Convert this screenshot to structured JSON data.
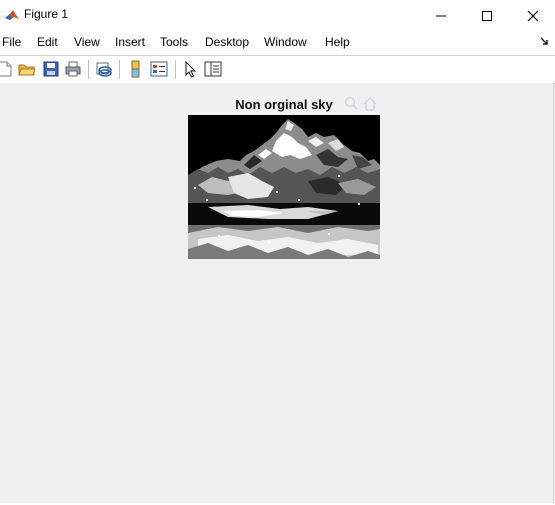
{
  "window": {
    "title": "Figure 1",
    "controls": [
      "minimize-icon",
      "maximize-icon",
      "close-icon"
    ]
  },
  "menu": {
    "items": [
      {
        "label": "File"
      },
      {
        "label": "Edit"
      },
      {
        "label": "View"
      },
      {
        "label": "Insert"
      },
      {
        "label": "Tools"
      },
      {
        "label": "Desktop"
      },
      {
        "label": "Window"
      },
      {
        "label": "Help"
      }
    ]
  },
  "toolbar": {
    "icons": [
      "new-figure-icon",
      "open-file-icon",
      "save-icon",
      "print-icon",
      "link-plot-icon",
      "insert-colorbar-icon",
      "insert-legend-icon",
      "edit-plot-icon",
      "property-inspector-icon"
    ]
  },
  "axes": {
    "title": "Non orginal sky",
    "tools": [
      "zoom-in-icon",
      "home-icon"
    ]
  },
  "colors": {
    "background": "#f0f0f0",
    "chrome": "#ffffff",
    "image_dark": "#000000",
    "image_light": "#ffffff"
  }
}
